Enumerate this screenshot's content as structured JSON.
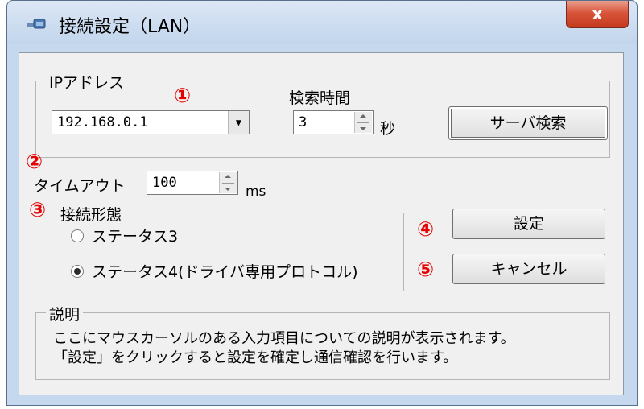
{
  "window": {
    "title": "接続設定（LAN）",
    "close_label": "x"
  },
  "ip_group": {
    "legend": "IPアドレス",
    "address_value": "192.168.0.1",
    "search_time_label": "検索時間",
    "search_time_value": "3",
    "search_time_unit": "秒",
    "server_search_label": "サーバ検索"
  },
  "timeout": {
    "label": "タイムアウト",
    "value": "100",
    "unit": "ms"
  },
  "connection_group": {
    "legend": "接続形態",
    "options": [
      {
        "label": "ステータス3",
        "selected": false
      },
      {
        "label": "ステータス4(ドライバ専用プロトコル)",
        "selected": true
      }
    ]
  },
  "buttons": {
    "settings_label": "設定",
    "cancel_label": "キャンセル"
  },
  "description": {
    "legend": "説明",
    "line1": "ここにマウスカーソルのある入力項目についての説明が表示されます。",
    "line2": "「設定」をクリックすると設定を確定し通信確認を行います。"
  },
  "markers": [
    "①",
    "②",
    "③",
    "④",
    "⑤"
  ]
}
